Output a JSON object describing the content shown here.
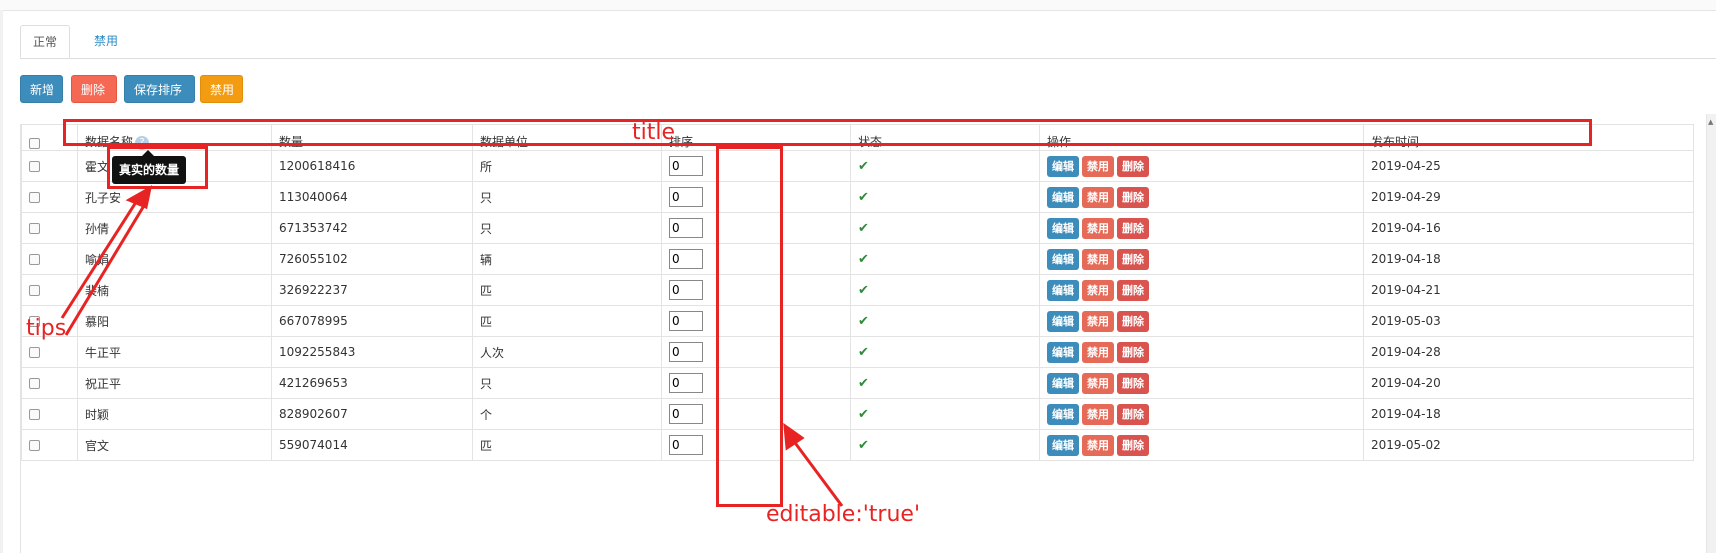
{
  "tabs": [
    {
      "label": "正常",
      "active": true
    },
    {
      "label": "禁用",
      "active": false
    }
  ],
  "toolbar": {
    "add_label": "新增",
    "delete_label": "删除",
    "save_sort_label": "保存排序",
    "disable_label": "禁用"
  },
  "table": {
    "headers": [
      "数据名称",
      "数量",
      "数据单位",
      "排序",
      "状态",
      "操作",
      "发布时间"
    ],
    "help_icon": "?",
    "rows": [
      {
        "name": "霍文",
        "qty": "1200618416",
        "unit": "所",
        "sort": "0",
        "date": "2019-04-25"
      },
      {
        "name": "孔子安",
        "qty": "113040064",
        "unit": "只",
        "sort": "0",
        "date": "2019-04-29"
      },
      {
        "name": "孙倩",
        "qty": "671353742",
        "unit": "只",
        "sort": "0",
        "date": "2019-04-16"
      },
      {
        "name": "喻娟",
        "qty": "726055102",
        "unit": "辆",
        "sort": "0",
        "date": "2019-04-18"
      },
      {
        "name": "裴楠",
        "qty": "326922237",
        "unit": "匹",
        "sort": "0",
        "date": "2019-04-21"
      },
      {
        "name": "慕阳",
        "qty": "667078995",
        "unit": "匹",
        "sort": "0",
        "date": "2019-05-03"
      },
      {
        "name": "牛正平",
        "qty": "1092255843",
        "unit": "人次",
        "sort": "0",
        "date": "2019-04-28"
      },
      {
        "name": "祝正平",
        "qty": "421269653",
        "unit": "只",
        "sort": "0",
        "date": "2019-04-20"
      },
      {
        "name": "时颖",
        "qty": "828902607",
        "unit": "个",
        "sort": "0",
        "date": "2019-04-18"
      },
      {
        "name": "官文",
        "qty": "559074014",
        "unit": "匹",
        "sort": "0",
        "date": "2019-05-02"
      }
    ],
    "status_icon": "check-icon",
    "actions": {
      "edit": "编辑",
      "disable": "禁用",
      "delete": "删除"
    }
  },
  "tooltip": {
    "text": "真实的数量"
  },
  "annotations": {
    "title_label": "title",
    "tips_label": "tips",
    "editable_label": "editable:'true'"
  },
  "colors": {
    "primary": "#3c8dbc",
    "danger": "#f56954",
    "warning": "#f39c12",
    "annotation": "#e82323",
    "check": "#2f8a3a"
  }
}
